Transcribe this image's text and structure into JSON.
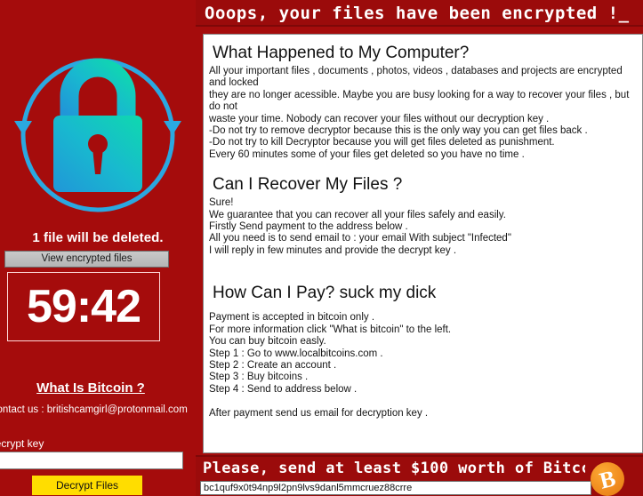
{
  "colors": {
    "background_red": "#a50c0c",
    "bar_red": "#9b0b0b",
    "panel_white": "#ffffff",
    "accent_yellow": "#ffdd00",
    "bitcoin_orange": "#f08b1e",
    "lock_cyan": "#2ba8e0",
    "lock_teal": "#16d3b5"
  },
  "header": {
    "title": "Ooops, your files have been encrypted !_"
  },
  "sidebar": {
    "lock_icon": "lock-with-refresh-arrows-icon",
    "files_deleted_text": "1 file will be deleted.",
    "view_files_button": "View encrypted files",
    "timer": "59:42",
    "what_is_bitcoin_link": "What Is Bitcoin ?",
    "contact_line": "Contact us :  britishcamgirl@protonmail.com",
    "decrypt_key_label": "Decrypt key",
    "decrypt_key_value": "",
    "decrypt_key_placeholder": "",
    "decrypt_files_button": "Decrypt Files"
  },
  "main": {
    "sections": [
      {
        "heading": "What Happened to My Computer?",
        "body": "All your important files , documents , photos, videos , databases and  projects are encrypted and locked\nthey are no longer acessible. Maybe you are busy looking for a way to recover your files , but do not\nwaste your time. Nobody can recover your files without our decryption key .\n-Do not try to remove decryptor because this is the only way you can get files back  .\n-Do not try to kill Decryptor because you will get files deleted as punishment.\nEvery 60 minutes some of your files get deleted so you have no time ."
      },
      {
        "heading": "Can I Recover My Files ?",
        "body": "Sure!\nWe guarantee that you can recover all your files safely and easily.\nFirstly Send payment to the address below .\nAll you need is to send email to : your email With subject \"Infected\"\nI will reply in few minutes and provide the decrypt key ."
      },
      {
        "heading": "How Can I Pay? suck my dick",
        "body": "Payment is accepted in bitcoin only .\nFor more information click \"What is bitcoin\" to the left.\nYou can buy bitcoin easly.\nStep 1 : Go to www.localbitcoins.com .\nStep 2 : Create an account .\nStep 3 : Buy bitcoins  .\nStep 4 : Send to address below ."
      }
    ],
    "pay_footer": "After payment send us email for decryption key ."
  },
  "bottom": {
    "title": "Please, send at least $100 worth of Bitcc",
    "btc_address": "bc1quf9x0t94np9l2pn9lvs9danl5mmcruez88crre",
    "btc_logo": "bitcoin-logo-icon"
  }
}
